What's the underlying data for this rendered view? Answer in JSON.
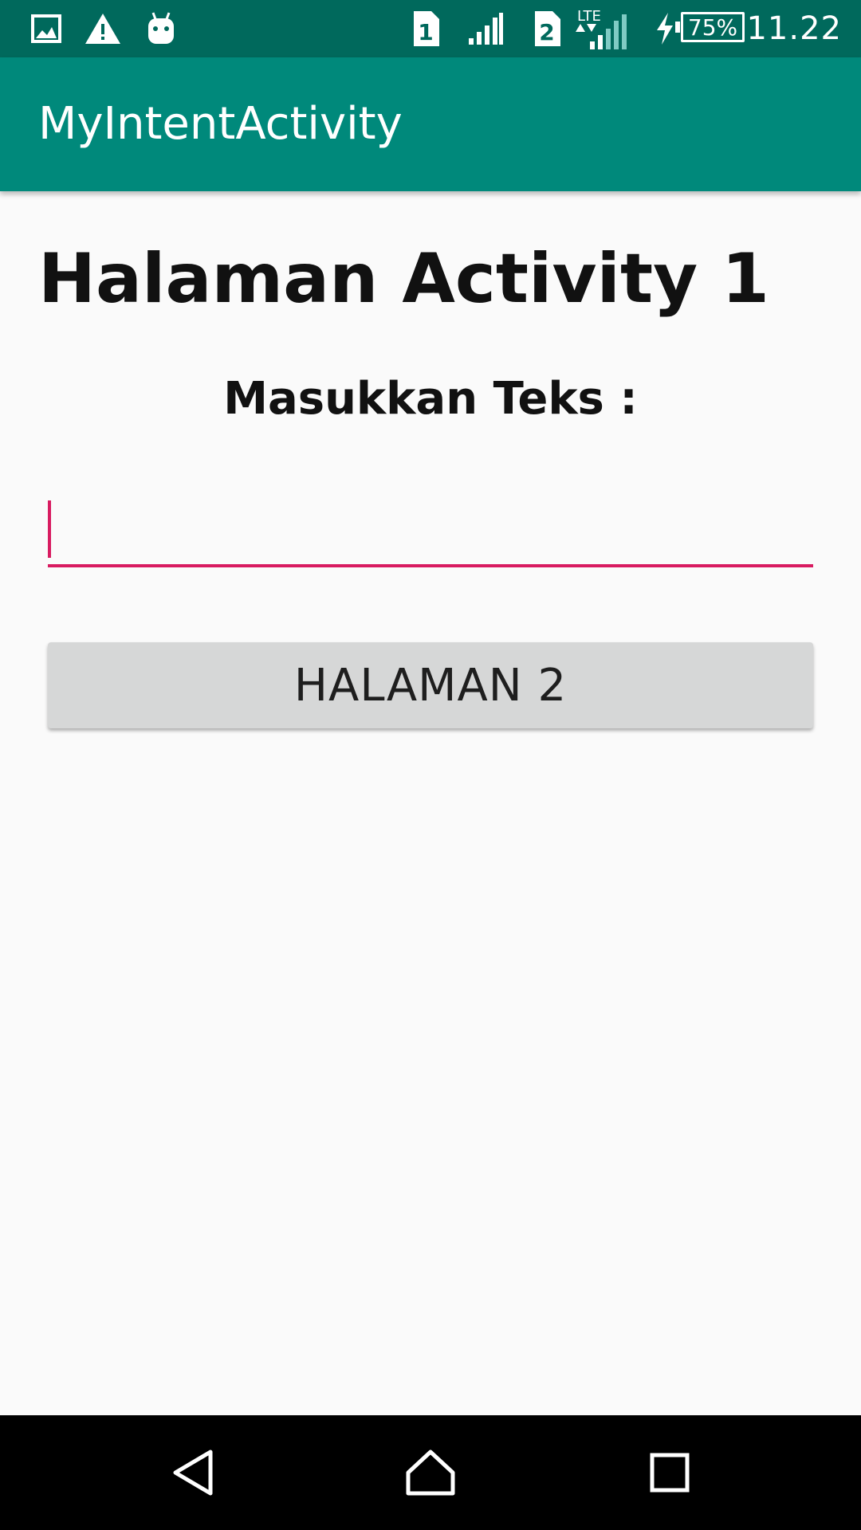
{
  "status_bar": {
    "time": "11.22",
    "battery": "75%",
    "sim1": "1",
    "sim2": "2",
    "network": "LTE",
    "icons": [
      "gallery-icon",
      "warning-icon",
      "android-icon",
      "sim-icon",
      "signal-icon",
      "sim-icon",
      "lte-icon",
      "signal-icon",
      "charging-icon",
      "battery-icon"
    ]
  },
  "app_bar": {
    "title": "MyIntentActivity"
  },
  "main": {
    "heading": "Halaman Activity 1",
    "prompt": "Masukkan Teks :",
    "input_value": "",
    "button_label": "HALAMAN 2"
  },
  "nav_bar": {
    "icons": [
      "back-icon",
      "home-icon",
      "recents-icon"
    ]
  },
  "colors": {
    "status_bar": "#00695c",
    "app_bar": "#00897b",
    "accent": "#d81b60",
    "button": "#d6d7d7"
  }
}
